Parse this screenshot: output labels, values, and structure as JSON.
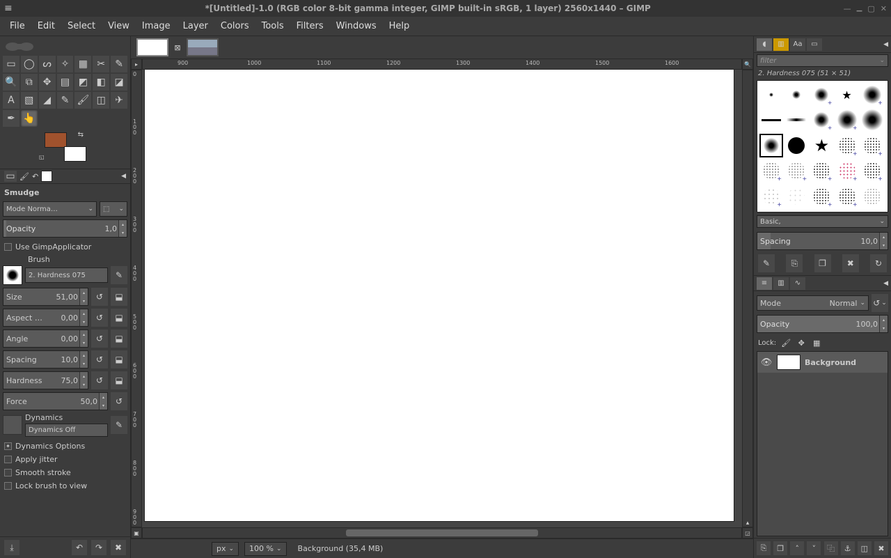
{
  "titlebar": {
    "title": "*[Untitled]-1.0 (RGB color 8-bit gamma integer, GIMP built-in sRGB, 1 layer) 2560x1440 – GIMP"
  },
  "menu": [
    "File",
    "Edit",
    "Select",
    "View",
    "Image",
    "Layer",
    "Colors",
    "Tools",
    "Filters",
    "Windows",
    "Help"
  ],
  "toolopts": {
    "name": "Smudge",
    "mode_label": "Mode",
    "mode_value": "Norma…",
    "opacity_label": "Opacity",
    "opacity_value": "1,0",
    "use_applicator": "Use GimpApplicator",
    "brush_heading": "Brush",
    "brush_name": "2. Hardness 075",
    "size_label": "Size",
    "size_value": "51,00",
    "aspect_label": "Aspect …",
    "aspect_value": "0,00",
    "angle_label": "Angle",
    "angle_value": "0,00",
    "spacing_label": "Spacing",
    "spacing_value": "10,0",
    "hardness_label": "Hardness",
    "hardness_value": "75,0",
    "force_label": "Force",
    "force_value": "50,0",
    "dynamics_heading": "Dynamics",
    "dynamics_value": "Dynamics Off",
    "dynamics_options": "Dynamics Options",
    "apply_jitter": "Apply jitter",
    "smooth_stroke": "Smooth stroke",
    "lock_brush": "Lock brush to view"
  },
  "colors": {
    "fg": "#a0522d",
    "bg": "#ffffff"
  },
  "ruler_h": [
    "900",
    "1000",
    "1100",
    "1200",
    "1300",
    "1400",
    "1500",
    "1600"
  ],
  "ruler_v": [
    "0",
    "100",
    "200",
    "300",
    "400",
    "500",
    "600",
    "700",
    "800",
    "900"
  ],
  "status": {
    "unit": "px",
    "zoom": "100 %",
    "info": "Background (35,4 MB)"
  },
  "brushes": {
    "filter_placeholder": "filter",
    "current": "2. Hardness 075 (51 × 51)",
    "tag": "Basic,",
    "spacing_label": "Spacing",
    "spacing_value": "10,0"
  },
  "layers": {
    "mode_label": "Mode",
    "mode_value": "Normal",
    "opacity_label": "Opacity",
    "opacity_value": "100,0",
    "lock_label": "Lock:",
    "layer_name": "Background"
  }
}
